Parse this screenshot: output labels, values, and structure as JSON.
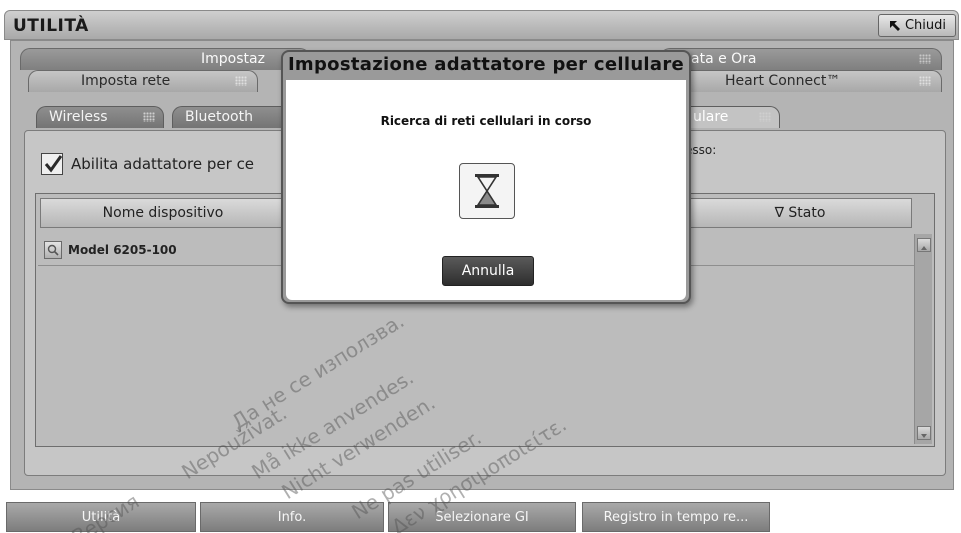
{
  "window": {
    "title": "UTILITÀ",
    "close_label": "Chiudi"
  },
  "tabs_row1": [
    {
      "label": "Impostaz"
    },
    {
      "label": "ata e Ora"
    }
  ],
  "tabs_row2": [
    {
      "label": "Imposta rete"
    },
    {
      "label": "Heart Connect™"
    }
  ],
  "subtabs": [
    {
      "label": "Wireless"
    },
    {
      "label": "Bluetooth"
    },
    {
      "label": "ulare"
    }
  ],
  "panel": {
    "enable_checkbox_label": "Abilita adattatore per ce",
    "enable_checked": true,
    "access_label": "esso:",
    "table": {
      "columns": [
        "Nome dispositivo",
        "∇ Stato"
      ],
      "rows": [
        {
          "name": "Model 6205-100"
        }
      ]
    }
  },
  "dialog": {
    "title": "Impostazione adattatore per cellulare",
    "message": "Ricerca di reti cellulari in corso",
    "icon": "hourglass-icon",
    "cancel_label": "Annulla"
  },
  "bottom_tabs": [
    {
      "label": "Utilità"
    },
    {
      "label": "Info."
    },
    {
      "label": "Selezionare GI"
    },
    {
      "label": "Registro in tempo re..."
    }
  ],
  "watermark": {
    "lines": [
      "Да не се използва.",
      "Nepoužívat.",
      "Må ikke anvendes.",
      "Nicht verwenden.",
      "Ne pas utiliser.",
      "Δεν χρησιμοποιείτε.",
      "Версия"
    ]
  },
  "colors": {
    "panel": "#b4b4b4",
    "dialog_body": "#ffffff",
    "cancel_button": "#3a3a3a"
  }
}
